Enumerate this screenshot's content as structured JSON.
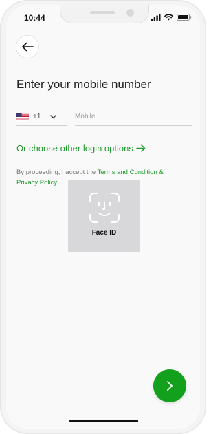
{
  "status_bar": {
    "time": "10:44",
    "icons": [
      "signal-icon",
      "wifi-icon",
      "battery-icon"
    ]
  },
  "header": {
    "back_icon": "arrow-left-icon"
  },
  "login": {
    "title": "Enter your mobile number",
    "country": {
      "flag": "us-flag-icon",
      "dial_code": "+1",
      "chevron": "chevron-down-icon"
    },
    "mobile_placeholder": "Mobile",
    "mobile_value": "",
    "other_options_label": "Or choose other login options",
    "other_options_icon": "arrow-right-icon",
    "terms_prefix": "By proceeding, I accept the ",
    "terms_link": "Terms and Condition",
    "terms_joiner": " & ",
    "privacy_link": "Privacy Policy"
  },
  "face_id": {
    "label": "Face ID",
    "icon": "face-id-icon"
  },
  "next_button": {
    "icon": "chevron-right-icon"
  },
  "colors": {
    "accent": "#13a01c",
    "link": "#1f9a2c",
    "background": "#f9f9f9",
    "face_id_panel": "#d8d8da"
  }
}
